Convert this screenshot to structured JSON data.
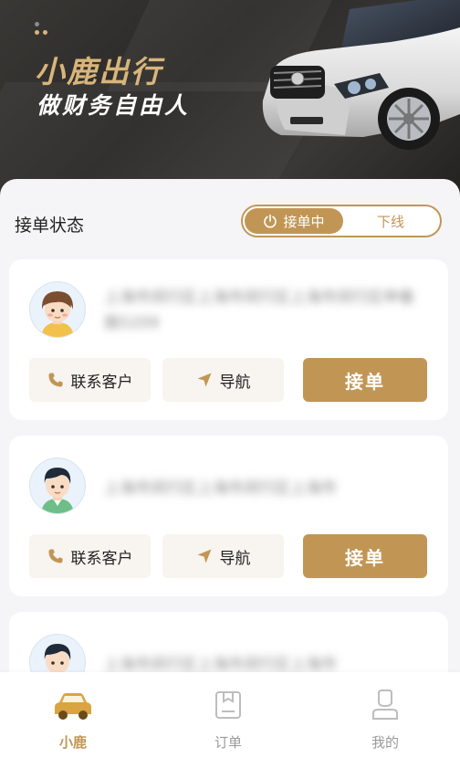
{
  "header": {
    "brand": "小鹿出行",
    "slogan": "做财务自由人"
  },
  "status": {
    "title": "接单状态",
    "toggle_on": "接单中",
    "toggle_off": "下线"
  },
  "orders": [
    {
      "address": "上海市闵行区上海市闵行区上海市闵行区申春路5209",
      "contact_label": "联系客户",
      "nav_label": "导航",
      "accept_label": "接单"
    },
    {
      "address": "上海市闵行区上海市闵行区上海市",
      "contact_label": "联系客户",
      "nav_label": "导航",
      "accept_label": "接单"
    },
    {
      "address": "上海市闵行区上海市闵行区上海市"
    }
  ],
  "tabbar": {
    "items": [
      {
        "label": "小鹿",
        "icon": "car-icon",
        "active": true
      },
      {
        "label": "订单",
        "icon": "order-icon",
        "active": false
      },
      {
        "label": "我的",
        "icon": "profile-icon",
        "active": false
      }
    ]
  },
  "colors": {
    "accent": "#c19655",
    "header_dark": "#2b2927",
    "brand_gold": "#d8b57b"
  }
}
